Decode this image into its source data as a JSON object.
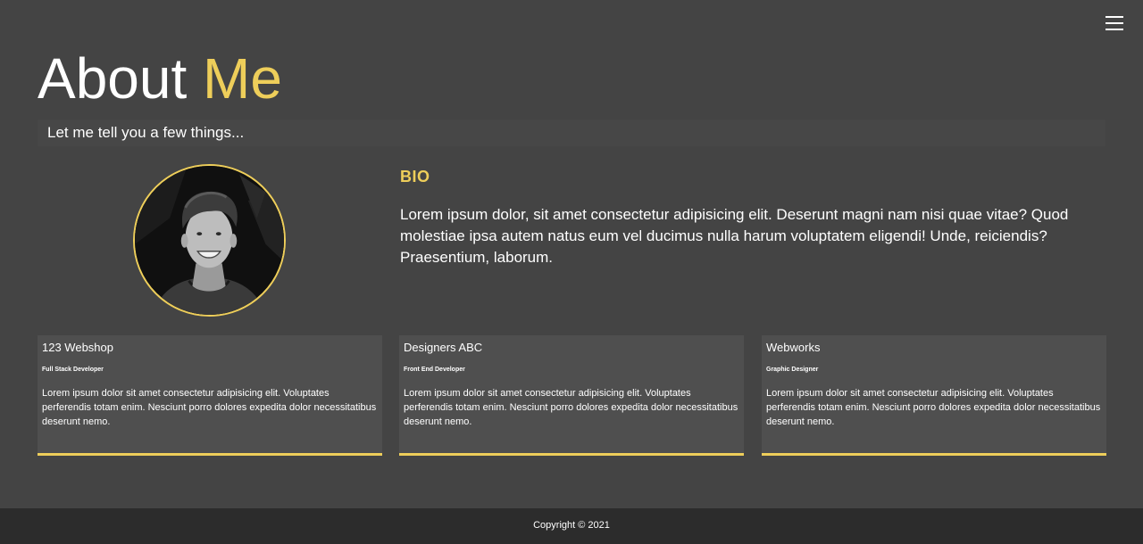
{
  "header": {
    "title_main": "About",
    "title_accent": "Me",
    "subtitle": "Let me tell you a few things...",
    "menu_icon": "hamburger-menu-icon"
  },
  "bio": {
    "heading": "BIO",
    "text": "Lorem ipsum dolor, sit amet consectetur adipisicing elit. Deserunt magni nam nisi quae vitae? Quod molestiae ipsa autem natus eum vel ducimus nulla harum voluptatem eligendi! Unde, reiciendis? Praesentium, laborum."
  },
  "jobs": [
    {
      "company": "123 Webshop",
      "role": "Full Stack Developer",
      "description": "Lorem ipsum dolor sit amet consectetur adipisicing elit. Voluptates perferendis totam enim. Nesciunt porro dolores expedita dolor necessitatibus deserunt nemo."
    },
    {
      "company": "Designers ABC",
      "role": "Front End Developer",
      "description": "Lorem ipsum dolor sit amet consectetur adipisicing elit. Voluptates perferendis totam enim. Nesciunt porro dolores expedita dolor necessitatibus deserunt nemo."
    },
    {
      "company": "Webworks",
      "role": "Graphic Designer",
      "description": "Lorem ipsum dolor sit amet consectetur adipisicing elit. Voluptates perferendis totam enim. Nesciunt porro dolores expedita dolor necessitatibus deserunt nemo."
    }
  ],
  "footer": {
    "copyright": "Copyright © 2021"
  },
  "colors": {
    "background": "#444444",
    "accent": "#eece5a",
    "card": "#4f4f4f",
    "footer": "#2c2c2c"
  }
}
